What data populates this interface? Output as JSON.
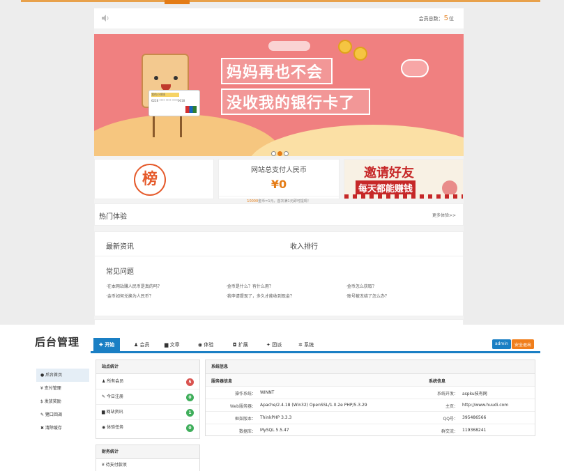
{
  "site": {
    "member_count_label": "会员总数：",
    "member_count_value": "5",
    "member_count_unit": "位",
    "banner": {
      "line1": "妈妈再也不会",
      "line2": "没收我的银行卡了",
      "card_label": "我的小钱钱",
      "card_number": "6228 **** **** ****0018"
    },
    "rank_glyph": "榜",
    "pay": {
      "title": "网站总支付人民币",
      "amount": "¥0",
      "note_highlight": "10000",
      "note_rest": "金币=1元，首次满1元即可提现！"
    },
    "invite": {
      "line1": "邀请好友",
      "line2": "每天都能赚钱"
    },
    "hot": {
      "title": "热门体验",
      "more": "更多体验>>"
    },
    "news": {
      "title": "最新资讯",
      "income_title": "收入排行"
    },
    "faq": {
      "title": "常见问题",
      "items": [
        "·在本网站赚人民币是真的吗？",
        "·金币是什么？有什么用？",
        "·金币怎么获取？",
        "·金币如何兑换为人民币？",
        "·我申请提现了，多久才能收到现金？",
        "·账号被冻结了怎么办？"
      ]
    }
  },
  "admin": {
    "logo": "后台管理",
    "nav": [
      "开始",
      "会员",
      "文章",
      "体验",
      "扩展",
      "团派",
      "系统"
    ],
    "user_badge": "admin",
    "logout_badge": "安全退出",
    "sidebar": [
      "后台首页",
      "¥ 支付管理",
      "$ 发放奖励",
      "✎ 猪口回调",
      "✖ 清除缓存"
    ],
    "stats": {
      "title": "站点统计",
      "rows": [
        {
          "label": "所有会员",
          "value": "5"
        },
        {
          "label": "今日注册",
          "value": "0"
        },
        {
          "label": "网站资讯",
          "value": "1"
        },
        {
          "label": "体验任务",
          "value": "0"
        }
      ]
    },
    "finance": {
      "title": "财务统计",
      "row": "¥ 待支付款项"
    },
    "sysinfo": {
      "title": "系统信息",
      "server_head": "服务器信息",
      "system_head": "系统信息",
      "left": [
        {
          "label": "操作系统：",
          "value": "WINNT"
        },
        {
          "label": "Web服务器：",
          "value": "Apache/2.4.18 (Win32) OpenSSL/1.0.2e PHP/5.3.29"
        },
        {
          "label": "框架版本：",
          "value": "ThinkPHP 3.3.3"
        },
        {
          "label": "数据库：",
          "value": "MySQL 5.5.47"
        }
      ],
      "right": [
        {
          "label": "系统开发：",
          "value": "aspku技有网"
        },
        {
          "label": "主页：",
          "value": "http://www.huudi.com"
        },
        {
          "label": "QQ号：",
          "value": "395486566"
        },
        {
          "label": "群交流：",
          "value": "119368241"
        }
      ]
    }
  },
  "colors": {
    "accent_orange": "#e47c16",
    "admin_blue": "#1a7fc4",
    "banner_pink": "#f08080"
  }
}
